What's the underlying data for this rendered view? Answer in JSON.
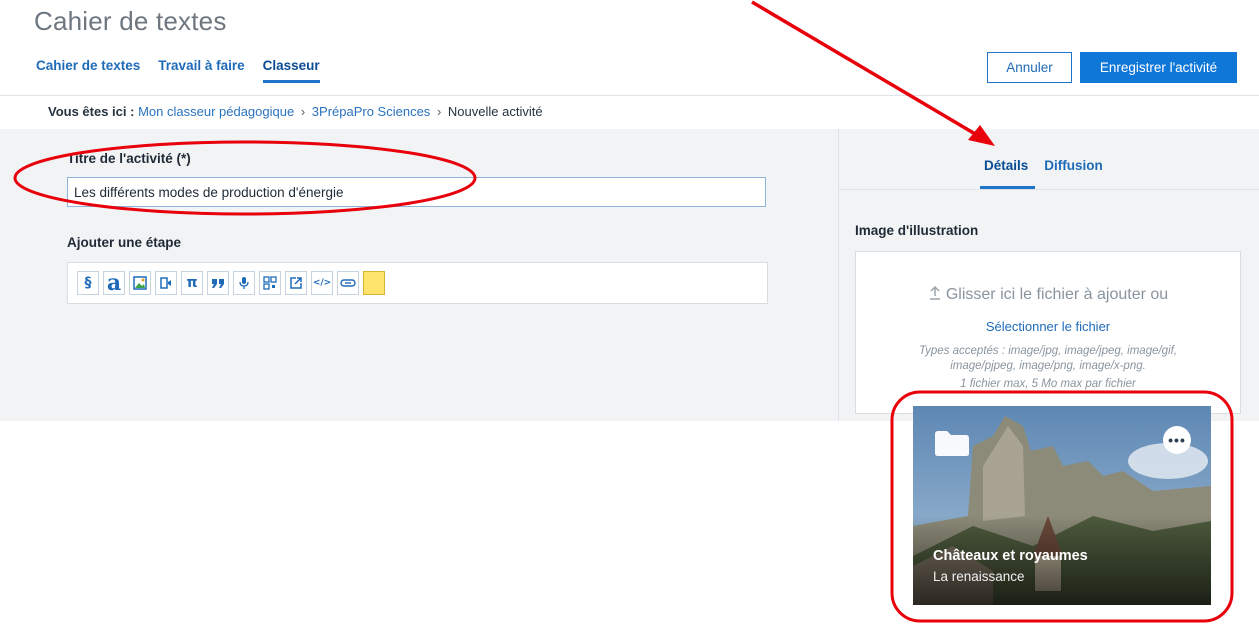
{
  "header": {
    "app_title": "Cahier de textes",
    "tabs": [
      {
        "label": "Cahier de textes"
      },
      {
        "label": "Travail à faire"
      },
      {
        "label": "Classeur"
      }
    ],
    "cancel_label": "Annuler",
    "save_label": "Enregistrer l'activité"
  },
  "breadcrumb": {
    "lead": "Vous êtes ici :",
    "items": [
      "Mon classeur pédagogique",
      "3PrépaPro Sciences",
      "Nouvelle activité"
    ],
    "separator": "›"
  },
  "form": {
    "title_label": "Titre de l'activité (*)",
    "title_value": "Les différents modes de production d'énergie",
    "step_label": "Ajouter une étape",
    "step_tools": [
      {
        "icon": "section-icon",
        "glyph": "§"
      },
      {
        "icon": "text-icon",
        "glyph": "a"
      },
      {
        "icon": "image-icon",
        "glyph": "🖼"
      },
      {
        "icon": "video-icon",
        "glyph": "▦"
      },
      {
        "icon": "formula-icon",
        "glyph": "π"
      },
      {
        "icon": "quote-icon",
        "glyph": "❞"
      },
      {
        "icon": "microphone-icon",
        "glyph": "🎙"
      },
      {
        "icon": "qr-code-icon",
        "glyph": "▣"
      },
      {
        "icon": "external-link-icon",
        "glyph": "↗"
      },
      {
        "icon": "code-icon",
        "glyph": "</>"
      },
      {
        "icon": "link-icon",
        "glyph": "∞"
      },
      {
        "icon": "note-icon",
        "glyph": ""
      }
    ]
  },
  "side": {
    "tabs": [
      {
        "label": "Détails"
      },
      {
        "label": "Diffusion"
      }
    ],
    "illustration_label": "Image d'illustration",
    "drop_text": "Glisser ici le fichier à ajouter ou",
    "select_link": "Sélectionner le fichier",
    "accepted_line1": "Types acceptés : image/jpg, image/jpeg, image/gif,",
    "accepted_line2": "image/pjpeg, image/png, image/x-png.",
    "limits": "1 fichier max, 5 Mo max par fichier"
  },
  "card": {
    "title": "Châteaux et royaumes",
    "subtitle": "La renaissance"
  },
  "colors": {
    "accent": "#0f77d8",
    "link": "#1f6bb8",
    "annotation": "#e8000b"
  }
}
